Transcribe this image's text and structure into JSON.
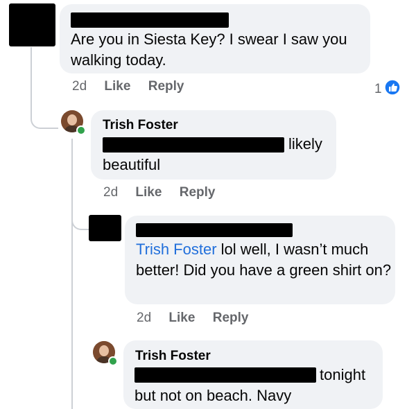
{
  "comments": [
    {
      "author": "",
      "text": "Are you in Siesta Key? I swear I saw you walking today.",
      "time": "2d",
      "like_label": "Like",
      "reply_label": "Reply",
      "reaction_count": "1",
      "reaction_icon": "thumbs-up-icon",
      "reaction_color": "#1877f2"
    },
    {
      "author": "Trish Foster",
      "text_suffix": "likely",
      "text_line2": "beautiful",
      "time": "2d",
      "like_label": "Like",
      "reply_label": "Reply",
      "online": true
    },
    {
      "author": "",
      "mention": "Trish Foster",
      "text": " lol well, I wasn’t much better! Did you have a green shirt on?",
      "time": "2d",
      "like_label": "Like",
      "reply_label": "Reply"
    },
    {
      "author": "Trish Foster",
      "text_suffix": "tonight",
      "text_line2": "but not on beach. Navy",
      "online": true
    }
  ],
  "colors": {
    "bubble": "#f0f2f5",
    "link": "#216fdb",
    "online": "#31a24c",
    "meta": "#65676b"
  }
}
